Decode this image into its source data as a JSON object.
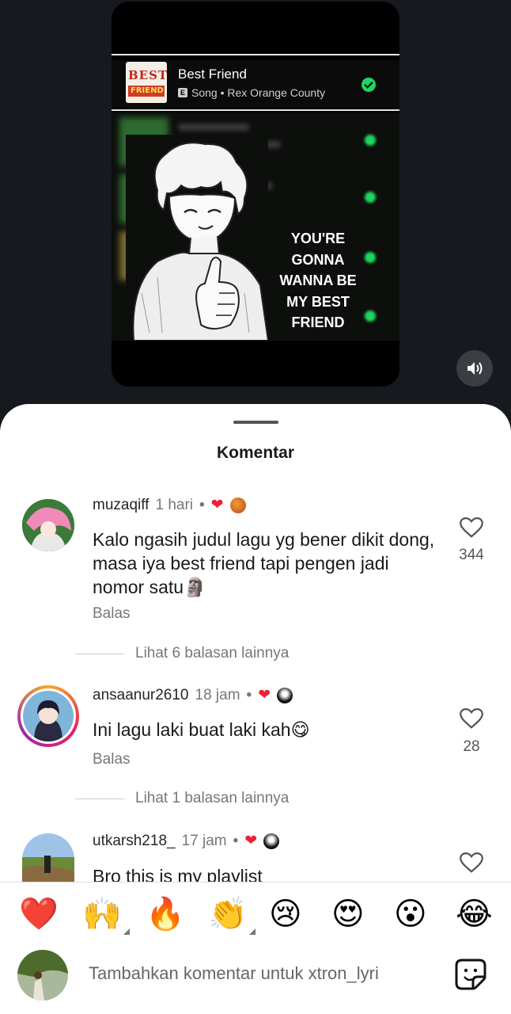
{
  "video": {
    "song": {
      "title": "Best Friend",
      "explicit_badge": "E",
      "meta": "Song • Rex Orange County",
      "cover_text_top": "BEST",
      "cover_text_bottom": "FRIEND"
    },
    "lyrics_lines": [
      "YOU'RE",
      "GONNA",
      "WANNA BE",
      "MY BEST",
      "FRIEND"
    ],
    "sound_icon": "speaker-icon"
  },
  "sheet": {
    "title": "Komentar"
  },
  "comments": [
    {
      "user": "muzaqiff",
      "time": "1 hari",
      "text": "Kalo ngasih judul lagu yg bener dikit dong, masa iya best friend tapi pengen jadi nomor satu🗿",
      "reply_label": "Balas",
      "likes": "344",
      "more_replies": "Lihat 6 balasan lainnya"
    },
    {
      "user": "ansaanur2610",
      "time": "18 jam",
      "text": "Ini lagu laki buat laki kah😋",
      "reply_label": "Balas",
      "likes": "28",
      "more_replies": "Lihat 1 balasan lainnya"
    },
    {
      "user": "utkarsh218_",
      "time": "17 jam",
      "text": "Bro this is my playlist"
    }
  ],
  "reactions": [
    "❤️",
    "🙌",
    "🔥",
    "👏",
    "😢",
    "😍",
    "😮",
    "😂"
  ],
  "input": {
    "placeholder": "Tambahkan komentar untuk xtron_lyri"
  },
  "colors": {
    "background_dark": "#16191d",
    "accent_green": "#1ed760",
    "heart_red": "#ed1f3a"
  }
}
